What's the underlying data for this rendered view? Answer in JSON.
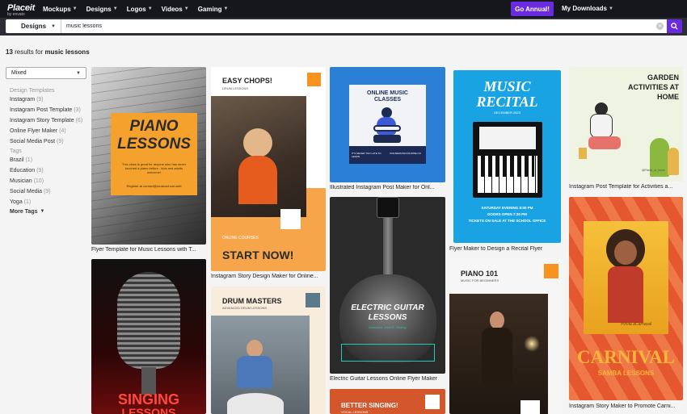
{
  "nav": {
    "logo_text": "Placeit",
    "logo_by": "by envato",
    "items": [
      {
        "label": "Mockups"
      },
      {
        "label": "Designs"
      },
      {
        "label": "Logos"
      },
      {
        "label": "Videos"
      },
      {
        "label": "Gaming"
      }
    ],
    "go_annual": "Go Annual!",
    "downloads": "My Downloads"
  },
  "search": {
    "category": "Designs",
    "query": "music lessons"
  },
  "results": {
    "count": "13",
    "mid": "results for",
    "term": "music lessons"
  },
  "sidebar": {
    "sort": "Mixed",
    "design_heading": "Design Templates",
    "design_items": [
      {
        "label": "Instagram",
        "count": "(9)"
      },
      {
        "label": "Instagram Post Template",
        "count": "(3)"
      },
      {
        "label": "Instagram Story Template",
        "count": "(6)"
      },
      {
        "label": "Online Flyer Maker",
        "count": "(4)"
      },
      {
        "label": "Social Media Post",
        "count": "(9)"
      }
    ],
    "tags_heading": "Tags",
    "tag_items": [
      {
        "label": "Brazil",
        "count": "(1)"
      },
      {
        "label": "Education",
        "count": "(9)"
      },
      {
        "label": "Musician",
        "count": "(10)"
      },
      {
        "label": "Social Media",
        "count": "(9)"
      },
      {
        "label": "Yoga",
        "count": "(1)"
      }
    ],
    "more_tags": "More Tags"
  },
  "cards": {
    "piano": {
      "title": "PIANO LESSONS",
      "body": "This class is great for anyone who has never touched a piano before - kids and adults welcome!",
      "contact": "Register at contact@musicschool.web",
      "caption": "Flyer Template for Music Lessons with T..."
    },
    "easy": {
      "title": "EASY CHOPS!",
      "sub": "DRUM LESSONS",
      "online": "ONLINE COURSES",
      "cta": "START NOW!",
      "caption": "Instagram Story Design Maker for Online..."
    },
    "classes": {
      "title": "ONLINE MUSIC CLASSES",
      "foot1": "IT'S NEVER TOO LATE TO LEARN",
      "foot2": "ONLINEMUSICCOURSE.CO",
      "caption": "Illustrated Instagram Post Maker for Onl..."
    },
    "recital": {
      "title": "MUSIC RECITAL",
      "date": "DECEMBER 2023",
      "info1": "SATURDAY EVENING 8:00 PM",
      "info2": "DOORS OPEN 7:30 PM",
      "info3": "TICKETS ON SALE AT THE SCHOOL OFFICE",
      "caption": "Flyer Maker to Design a Recital Flyer"
    },
    "garden": {
      "title": "GARDEN ACTIVITIES AT HOME",
      "handle": "@Plants_at_home",
      "caption": "Instagram Post Template for Activities a..."
    },
    "guitar": {
      "title": "ELECTRIC GUITAR LESSONS",
      "instructor": "Instructor: John R. Searcy",
      "caption": "Electric Guitar Lessons Online Flyer Maker"
    },
    "piano101": {
      "title": "PIANO 101",
      "sub": "MUSIC FOR BEGINNERS"
    },
    "carnival": {
      "tag": "#VivaLaCarnaval",
      "title": "CARNIVAL",
      "sub": "SAMBA LESSONS",
      "caption": "Instagram Story Maker to Promote Carni..."
    },
    "drum": {
      "title": "DRUM MASTERS",
      "sub": "ADVANCED DRUM LESSONS"
    },
    "singing": {
      "title": "SINGING",
      "sub": "LESSONS"
    },
    "better": {
      "title": "BETTER SINGING!",
      "sub": "VOCAL LESSONS"
    }
  }
}
